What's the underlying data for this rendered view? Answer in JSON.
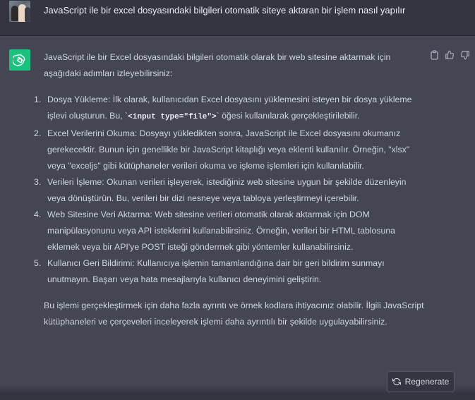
{
  "user_message": {
    "text": "JavaScript ile bir excel dosyasındaki bilgileri otomatik siteye aktaran bir işlem nasıl yapılır"
  },
  "assistant_message": {
    "intro": "JavaScript ile bir Excel dosyasındaki bilgileri otomatik olarak bir web sitesine aktarmak için aşağıdaki adımları izleyebilirsiniz:",
    "steps": [
      {
        "num": "1.",
        "before": "Dosya Yükleme: İlk olarak, kullanıcıdan Excel dosyasını yüklemesini isteyen bir dosya yükleme işlevi oluşturun. Bu, `",
        "code_tag": "<input type=",
        "code_str": "\"file\"",
        "code_end": ">",
        "after": "` öğesi kullanılarak gerçekleştirilebilir."
      },
      {
        "num": "2.",
        "text": "Excel Verilerini Okuma: Dosyayı yükledikten sonra, JavaScript ile Excel dosyasını okumanız gerekecektir. Bunun için genellikle bir JavaScript kitaplığı veya eklenti kullanılır. Örneğin, \"xlsx\" veya \"exceljs\" gibi kütüphaneler verileri okuma ve işleme işlemleri için kullanılabilir."
      },
      {
        "num": "3.",
        "text": "Verileri İşleme: Okunan verileri işleyerek, istediğiniz web sitesine uygun bir şekilde düzenleyin veya dönüştürün. Bu, verileri bir dizi nesneye veya tabloya yerleştirmeyi içerebilir."
      },
      {
        "num": "4.",
        "text": "Web Sitesine Veri Aktarma: Web sitesine verileri otomatik olarak aktarmak için DOM manipülasyonunu veya API isteklerini kullanabilirsiniz. Örneğin, verileri bir HTML tablosuna eklemek veya bir API'ye POST isteği göndermek gibi yöntemler kullanabilirsiniz."
      },
      {
        "num": "5.",
        "text": "Kullanıcı Geri Bildirimi: Kullanıcıya işlemin tamamlandığına dair bir geri bildirim sunmayı unutmayın. Başarı veya hata mesajlarıyla kullanıcı deneyimini geliştirin."
      }
    ],
    "outro": "Bu işlemi gerçekleştirmek için daha fazla ayrıntı ve örnek kodlara ihtiyacınız olabilir. İlgili JavaScript kütüphaneleri ve çerçeveleri inceleyerek işlemi daha ayrıntılı bir şekilde uygulayabilirsiniz."
  },
  "regenerate_label": "Regenerate",
  "colors": {
    "background": "#444654",
    "user_row": "#343541",
    "accent": "#19c37d"
  }
}
